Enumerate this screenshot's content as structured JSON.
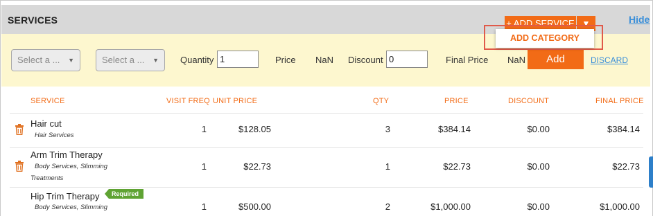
{
  "header": {
    "title": "SERVICES",
    "add_service_label": "+ ADD SERVICE",
    "add_service_caret": "▼",
    "hide_label": "Hide"
  },
  "dropdown": {
    "add_category_label": "ADD CATEGORY"
  },
  "input_row": {
    "select1_placeholder": "Select a ...",
    "select2_placeholder": "Select a ...",
    "quantity_label": "Quantity",
    "quantity_value": "1",
    "price_label": "Price",
    "price_value": "NaN",
    "discount_label": "Discount",
    "discount_value": "0",
    "final_price_label": "Final Price",
    "final_price_value": "NaN",
    "add_label": "Add",
    "discard_label": "DISCARD"
  },
  "table": {
    "columns": {
      "service": "SERVICE",
      "visit_freq": "VISIT FREQ",
      "unit_price": "UNIT PRICE",
      "qty": "QTY",
      "price": "PRICE",
      "discount": "DISCOUNT",
      "final_price": "FINAL PRICE"
    },
    "rows": [
      {
        "name": "Hair cut",
        "category_line1": "Hair Services",
        "category_line2": "",
        "visit_freq": "1",
        "unit_price": "$128.05",
        "qty": "3",
        "price": "$384.14",
        "discount": "$0.00",
        "final_price": "$384.14"
      },
      {
        "name": "Arm Trim Therapy",
        "category_line1": "Body Services, Slimming",
        "category_line2": "Treatments",
        "visit_freq": "1",
        "unit_price": "$22.73",
        "qty": "1",
        "price": "$22.73",
        "discount": "$0.00",
        "final_price": "$22.73"
      },
      {
        "name": "Hip Trim Therapy",
        "badge": "Required",
        "category_line1": "Body Services, Slimming",
        "category_line2": "",
        "visit_freq": "1",
        "unit_price": "$500.00",
        "qty": "2",
        "price": "$1,000.00",
        "discount": "$0.00",
        "final_price": "$1,000.00"
      }
    ]
  },
  "colors": {
    "accent": "#f26b16",
    "link": "#3b8fd9",
    "badge": "#5fa333",
    "input_row_bg": "#fdf7cf",
    "header_bg": "#d8d8d8",
    "highlight_outline": "#e05a4a"
  }
}
